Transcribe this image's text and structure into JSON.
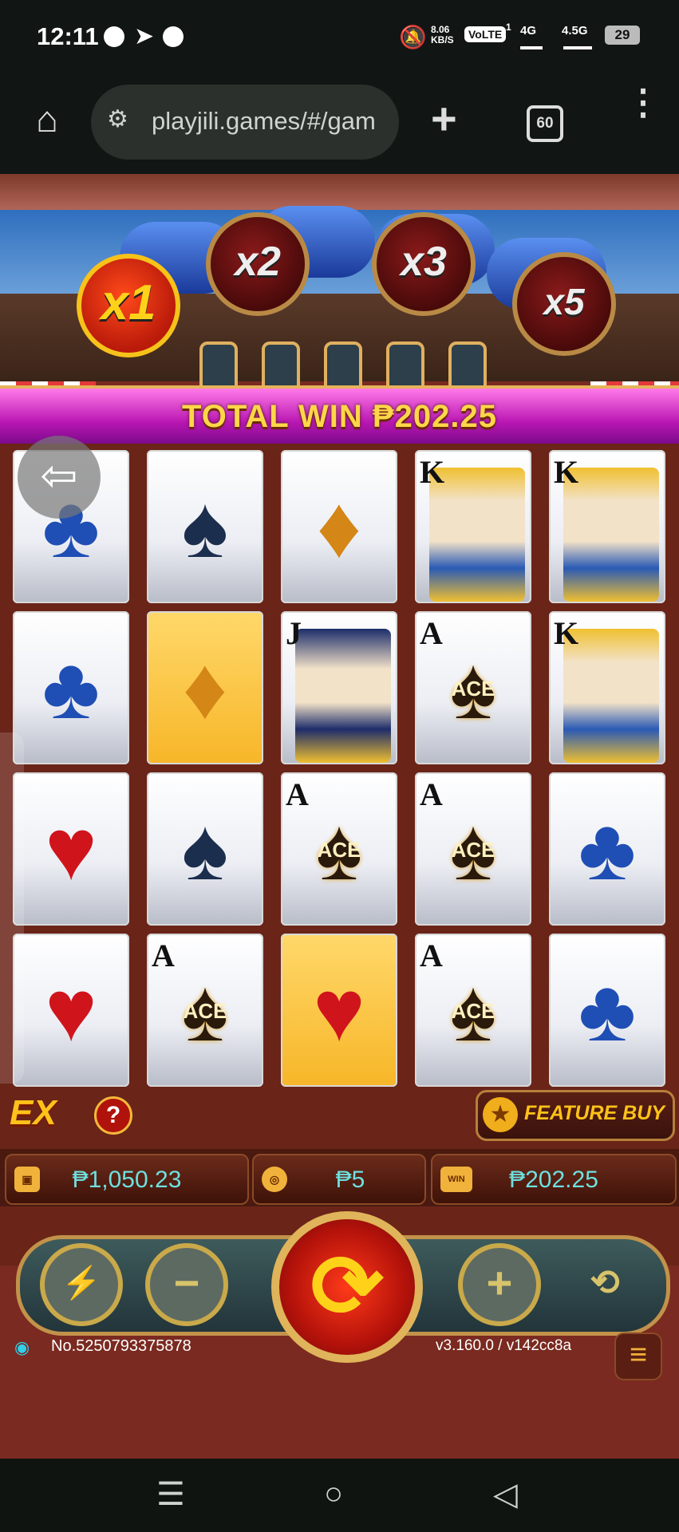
{
  "status_bar": {
    "time": "12:11",
    "net_speed_top": "8.06",
    "net_speed_bottom": "KB/S",
    "volte": "VoLTE",
    "sim1": "1",
    "signal1": "4G",
    "signal2": "4.5G",
    "battery": "29"
  },
  "browser": {
    "url": "playjili.games/#/gam",
    "tab_count": "60"
  },
  "game": {
    "multipliers": [
      "x1",
      "x2",
      "x3",
      "x5"
    ],
    "total_win": "TOTAL WIN ₱202.25",
    "reels": [
      [
        {
          "sym": "club"
        },
        {
          "sym": "spade"
        },
        {
          "sym": "diamond"
        },
        {
          "sym": "king",
          "corner": "K"
        },
        {
          "sym": "king",
          "corner": "K"
        }
      ],
      [
        {
          "sym": "club"
        },
        {
          "sym": "diamond",
          "gold": true
        },
        {
          "sym": "jack",
          "corner": "J"
        },
        {
          "sym": "ace",
          "corner": "A",
          "label": "ACE"
        },
        {
          "sym": "king",
          "corner": "K"
        }
      ],
      [
        {
          "sym": "heart"
        },
        {
          "sym": "spade"
        },
        {
          "sym": "ace",
          "corner": "A",
          "label": "ACE"
        },
        {
          "sym": "ace",
          "corner": "A",
          "label": "ACE"
        },
        {
          "sym": "club"
        }
      ],
      [
        {
          "sym": "heart"
        },
        {
          "sym": "ace",
          "corner": "A",
          "label": "ACE"
        },
        {
          "sym": "heart",
          "gold": true
        },
        {
          "sym": "ace",
          "corner": "A",
          "label": "ACE"
        },
        {
          "sym": "club"
        }
      ]
    ],
    "ex_logo": "EX",
    "help": "?",
    "feature_buy": "FEATURE BUY",
    "balance": "₱1,050.23",
    "bet": "₱5",
    "win": "₱202.25",
    "win_icon_text": "WIN",
    "connection_id": "No.5250793375878",
    "version": "v3.160.0 / v142cc8a"
  },
  "colors": {
    "accent_gold": "#f0b23a",
    "win_text": "#6ee0df",
    "banner_magenta": "#b917b3"
  }
}
